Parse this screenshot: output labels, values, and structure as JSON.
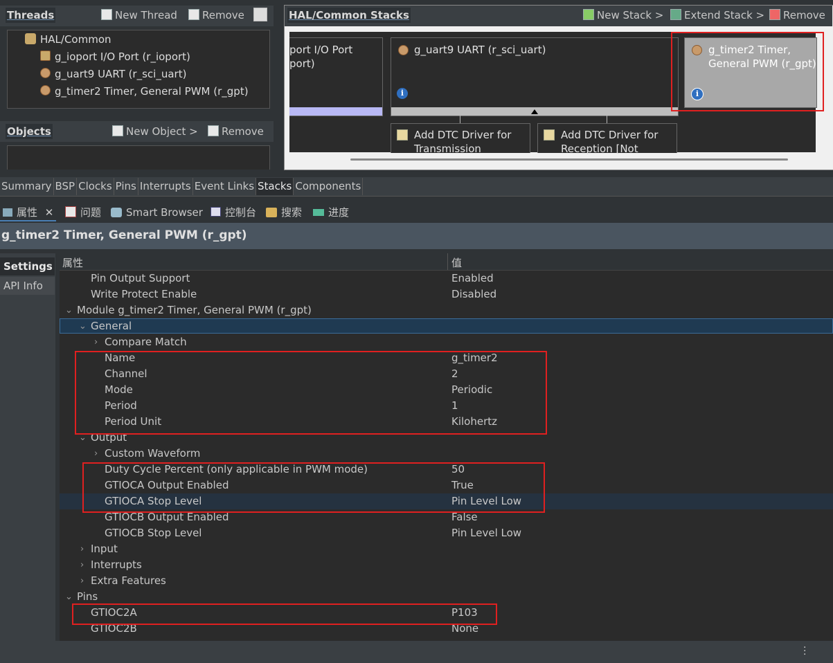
{
  "threads": {
    "title": "Threads",
    "new_thread": "New Thread",
    "remove": "Remove",
    "tree": [
      "HAL/Common",
      "g_ioport I/O Port (r_ioport)",
      "g_uart9 UART (r_sci_uart)",
      "g_timer2 Timer, General PWM (r_gpt)"
    ]
  },
  "objects": {
    "title": "Objects",
    "new_object": "New Object >",
    "remove": "Remove"
  },
  "stacks": {
    "title": "HAL/Common Stacks",
    "new_stack": "New Stack >",
    "extend_stack": "Extend Stack >",
    "remove": "Remove",
    "card_ioport_l1": "port I/O Port",
    "card_ioport_l2": "port)",
    "card_uart": "g_uart9 UART (r_sci_uart)",
    "card_timer_l1": "g_timer2 Timer,",
    "card_timer_l2": "General PWM (r_gpt)",
    "dtc_tx_l1": "Add DTC Driver for",
    "dtc_tx_l2": "Transmission",
    "dtc_rx_l1": "Add DTC Driver for",
    "dtc_rx_l2": "Reception [Not"
  },
  "config_tabs": [
    "Summary",
    "BSP",
    "Clocks",
    "Pins",
    "Interrupts",
    "Event Links",
    "Stacks",
    "Components"
  ],
  "view_tabs": {
    "properties": "属性",
    "problems": "问题",
    "smart_browser": "Smart Browser",
    "console": "控制台",
    "search": "搜索",
    "progress": "进度"
  },
  "props": {
    "title": "g_timer2 Timer, General PWM (r_gpt)",
    "side_settings": "Settings",
    "side_api": "API Info",
    "col_property": "属性",
    "col_value": "值",
    "rows": [
      {
        "k": "Pin Output Support",
        "v": "Enabled"
      },
      {
        "k": "Write Protect Enable",
        "v": "Disabled"
      },
      {
        "k": "Module g_timer2 Timer, General PWM (r_gpt)",
        "v": ""
      },
      {
        "k": "General",
        "v": ""
      },
      {
        "k": "Compare Match",
        "v": ""
      },
      {
        "k": "Name",
        "v": "g_timer2"
      },
      {
        "k": "Channel",
        "v": "2"
      },
      {
        "k": "Mode",
        "v": "Periodic"
      },
      {
        "k": "Period",
        "v": "1"
      },
      {
        "k": "Period Unit",
        "v": "Kilohertz"
      },
      {
        "k": "Output",
        "v": ""
      },
      {
        "k": "Custom Waveform",
        "v": ""
      },
      {
        "k": "Duty Cycle Percent (only applicable in PWM mode)",
        "v": "50"
      },
      {
        "k": "GTIOCA Output Enabled",
        "v": "True"
      },
      {
        "k": "GTIOCA Stop Level",
        "v": "Pin Level Low"
      },
      {
        "k": "GTIOCB Output Enabled",
        "v": "False"
      },
      {
        "k": "GTIOCB Stop Level",
        "v": "Pin Level Low"
      },
      {
        "k": "Input",
        "v": ""
      },
      {
        "k": "Interrupts",
        "v": ""
      },
      {
        "k": "Extra Features",
        "v": ""
      },
      {
        "k": "Pins",
        "v": ""
      },
      {
        "k": "GTIOC2A",
        "v": "P103"
      },
      {
        "k": "GTIOC2B",
        "v": "None"
      }
    ]
  },
  "colors": {
    "highlight_red": "#e02020",
    "selection": "#1f3a52"
  }
}
